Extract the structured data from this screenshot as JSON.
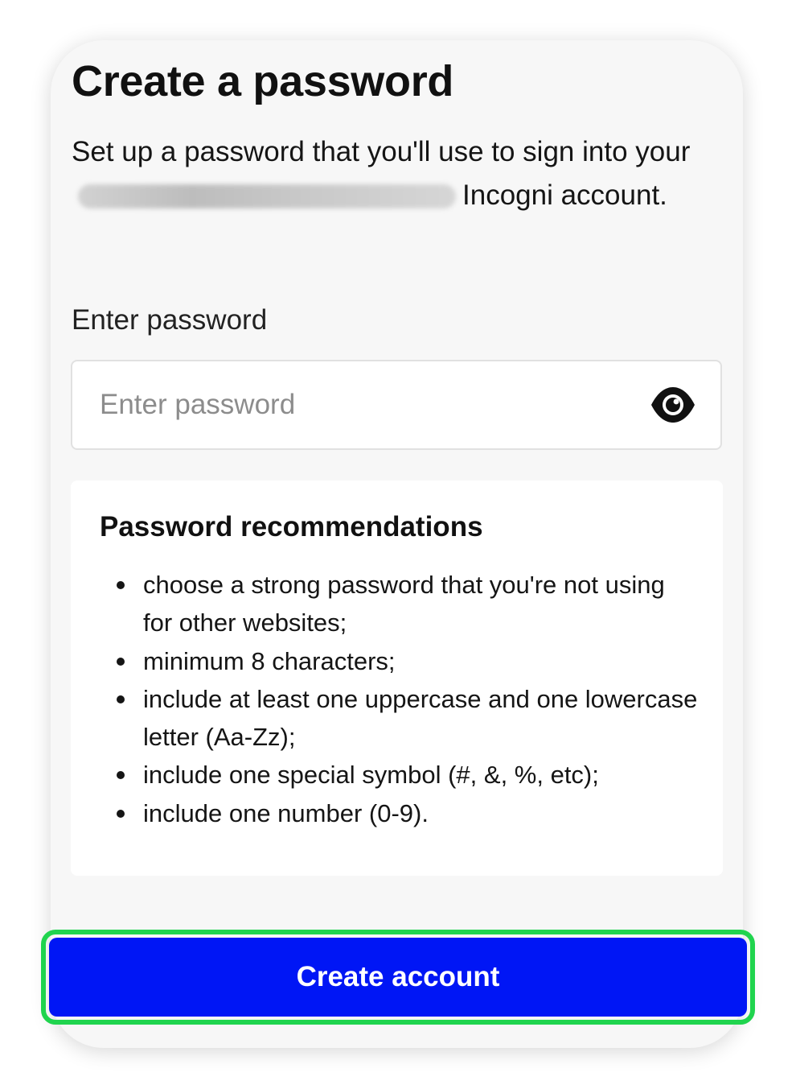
{
  "page": {
    "title": "Create a password",
    "subtitle": {
      "before": "Set up a password that you'll use to sign into your",
      "after": "Incogni account."
    }
  },
  "password_field": {
    "label": "Enter password",
    "placeholder": "Enter password",
    "value": "",
    "icon": "eye-icon"
  },
  "recommendations": {
    "title": "Password recommendations",
    "items": [
      "choose a strong password that you're not using for other websites;",
      "minimum 8 characters;",
      "include at least one uppercase and one lowercase letter (Aa-Zz);",
      "include one special symbol (#, &, %, etc);",
      "include one number (0-9)."
    ]
  },
  "actions": {
    "create_label": "Create account"
  },
  "colors": {
    "primary_button": "#0016f5",
    "highlight_outline": "#20d44e",
    "card_background": "#f7f7f7"
  }
}
